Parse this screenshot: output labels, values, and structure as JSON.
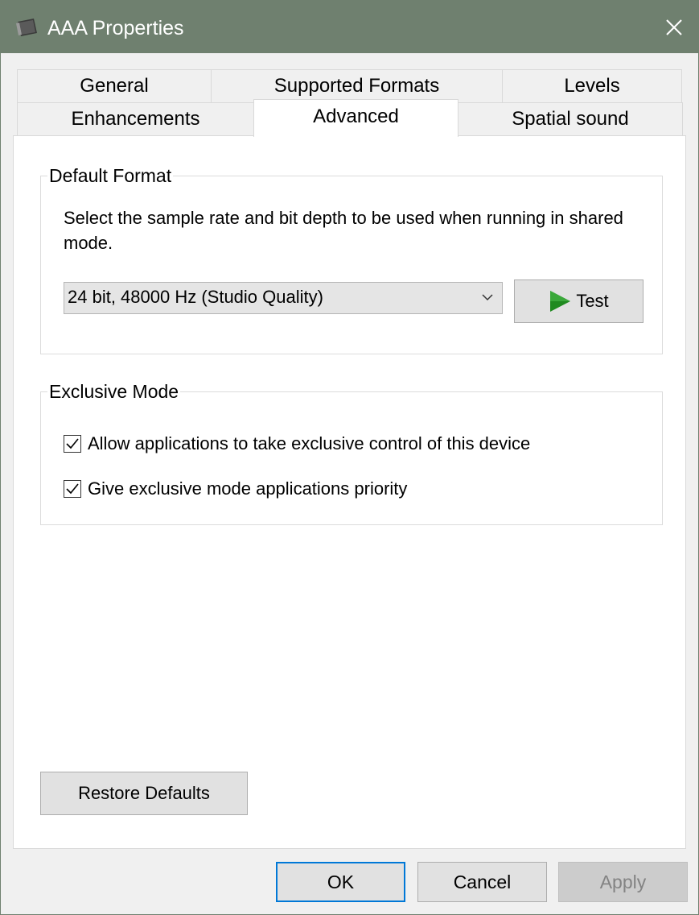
{
  "window": {
    "title": "AAA Properties"
  },
  "tabs": {
    "row1": [
      {
        "label": "General"
      },
      {
        "label": "Supported Formats"
      },
      {
        "label": "Levels"
      }
    ],
    "row2": [
      {
        "label": "Enhancements"
      },
      {
        "label": "Advanced",
        "active": true
      },
      {
        "label": "Spatial sound"
      }
    ]
  },
  "default_format": {
    "group_label": "Default Format",
    "description": "Select the sample rate and bit depth to be used when running in shared mode.",
    "selected_format": "24 bit, 48000 Hz (Studio Quality)",
    "test_label": "Test"
  },
  "exclusive_mode": {
    "group_label": "Exclusive Mode",
    "options": [
      {
        "label": "Allow applications to take exclusive control of this device",
        "checked": true
      },
      {
        "label": "Give exclusive mode applications priority",
        "checked": true
      }
    ]
  },
  "restore_defaults_label": "Restore Defaults",
  "footer": {
    "ok_label": "OK",
    "cancel_label": "Cancel",
    "apply_label": "Apply"
  },
  "colors": {
    "titlebar": "#6f806f",
    "accent": "#0078d7",
    "play_icon": "#1f8a1f"
  }
}
